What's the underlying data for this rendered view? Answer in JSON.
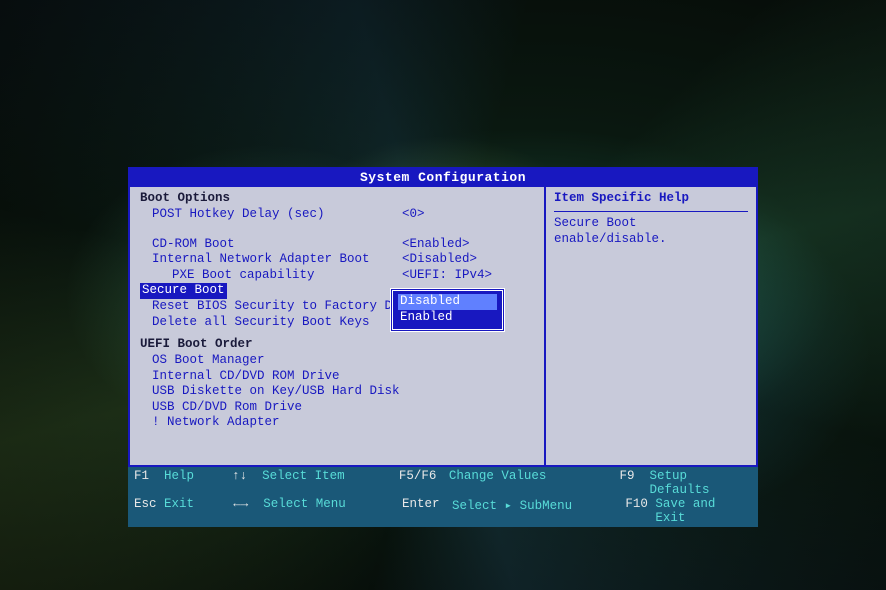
{
  "title": "System Configuration",
  "sections": {
    "boot_options_header": "Boot Options",
    "post_hotkey": {
      "label": "POST Hotkey Delay (sec)",
      "value": "<0>"
    },
    "cdrom_boot": {
      "label": "CD-ROM Boot",
      "value": "<Enabled>"
    },
    "net_adapter_boot": {
      "label": "Internal Network Adapter Boot",
      "value": "<Disabled>"
    },
    "pxe": {
      "label": "PXE Boot capability",
      "value": "<UEFI: IPv4>"
    },
    "secure_boot": {
      "label": "Secure Boot"
    },
    "reset_bios": {
      "label": "Reset BIOS Security to Factory Default"
    },
    "delete_keys": {
      "label": "Delete all Security Boot Keys"
    },
    "uefi_header": "UEFI Boot Order",
    "uefi_items": {
      "os_boot": "OS Boot Manager",
      "cddvd": "Internal CD/DVD ROM Drive",
      "usb_disk": "USB Diskette on Key/USB Hard Disk",
      "usb_cd": "USB CD/DVD Rom Drive",
      "net": "! Network Adapter"
    }
  },
  "popup": {
    "options": [
      "Disabled",
      "Enabled"
    ],
    "highlighted_index": 0
  },
  "help": {
    "title": "Item Specific Help",
    "text": "Secure Boot enable/disable."
  },
  "footer": {
    "f1": {
      "key": "F1",
      "action": "Help"
    },
    "updown": {
      "key": "↑↓",
      "action": "Select Item"
    },
    "f5f6": {
      "key": "F5/F6",
      "action": "Change Values"
    },
    "f9": {
      "key": "F9",
      "action": "Setup Defaults"
    },
    "esc": {
      "key": "Esc",
      "action": "Exit"
    },
    "leftright": {
      "key": "←→",
      "action": "Select Menu"
    },
    "enter": {
      "key": "Enter",
      "action": "Select ▸ SubMenu"
    },
    "f10": {
      "key": "F10",
      "action": "Save and Exit"
    }
  }
}
